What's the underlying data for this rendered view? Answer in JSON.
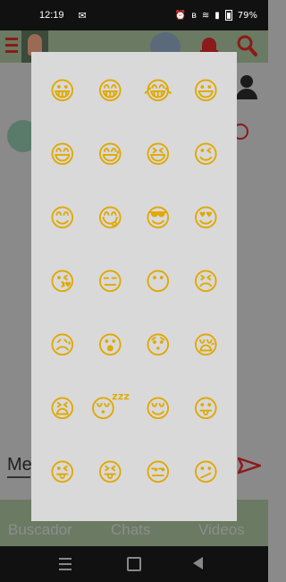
{
  "status_bar": {
    "time": "12:19",
    "battery": "79%"
  },
  "app_bar": {
    "title": ""
  },
  "message_input": {
    "label": "Me"
  },
  "bottom_nav": {
    "tabs": [
      "Buscador",
      "Chats",
      "Videos"
    ]
  },
  "emoji_panel": {
    "emojis": [
      "😀",
      "😁",
      "😂",
      "😃",
      "😄",
      "😅",
      "😆",
      "😉",
      "😊",
      "😋",
      "😎",
      "😍",
      "😘",
      "😑",
      "😶",
      "😣",
      "😥",
      "😮",
      "😯",
      "😪",
      "😫",
      "😴",
      "😌",
      "😛",
      "😜",
      "😝",
      "😒",
      "😕",
      "😓",
      "😓",
      "😓",
      "😓"
    ]
  },
  "colors": {
    "app_bar": "#6b7a62",
    "accent_red": "#8b1a1a",
    "panel_bg": "#d9d9d9"
  }
}
